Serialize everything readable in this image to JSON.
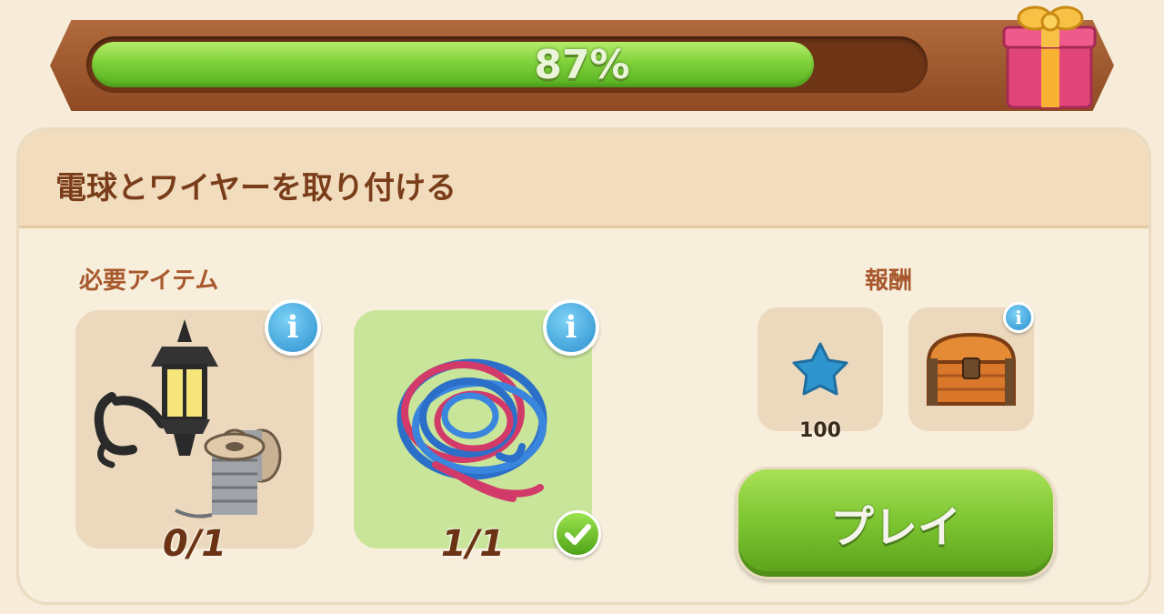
{
  "progress": {
    "percent_text": "87%",
    "fraction": 0.87
  },
  "task": {
    "title": "電球とワイヤーを取り付ける"
  },
  "required_items": {
    "label": "必要アイテム",
    "items": [
      {
        "name": "lamp-and-spools",
        "count": "0/1",
        "complete": false
      },
      {
        "name": "wire-coil",
        "count": "1/1",
        "complete": true
      }
    ]
  },
  "rewards": {
    "label": "報酬",
    "items": [
      {
        "icon": "star-icon",
        "amount": "100",
        "color": "#2e95cf"
      },
      {
        "icon": "treasure-chest-icon"
      }
    ]
  },
  "play_button": {
    "label": "プレイ"
  },
  "colors": {
    "progress_green": "#7fd13a",
    "title_brown": "#7a3d1a",
    "panel_bg": "#f7eedc",
    "info_blue": "#2b8fd0"
  }
}
